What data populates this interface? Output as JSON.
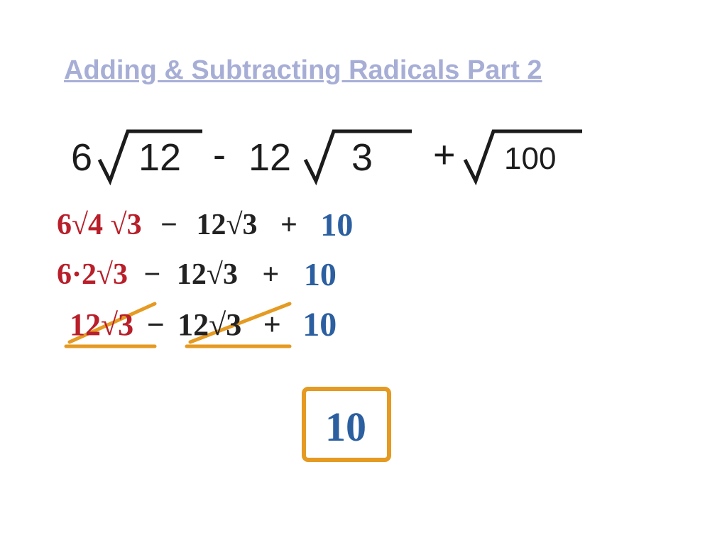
{
  "title": "Adding & Subtracting Radicals Part 2",
  "problem": {
    "coef1": "6",
    "rad1": "12",
    "op1": "-",
    "coef2": "12",
    "rad2": "3",
    "op2": "+",
    "rad3": "100"
  },
  "step1": {
    "red": "6√4 √3",
    "op1": "−",
    "mid": "12√3",
    "op2": "+",
    "blue": "10"
  },
  "step2": {
    "red": "6·2√3",
    "op1": "−",
    "mid": "12√3",
    "op2": "+",
    "blue": "10"
  },
  "step3": {
    "red": "12√3",
    "op1": "−",
    "mid": "12√3",
    "op2": "+",
    "blue": "10"
  },
  "answer": "10"
}
